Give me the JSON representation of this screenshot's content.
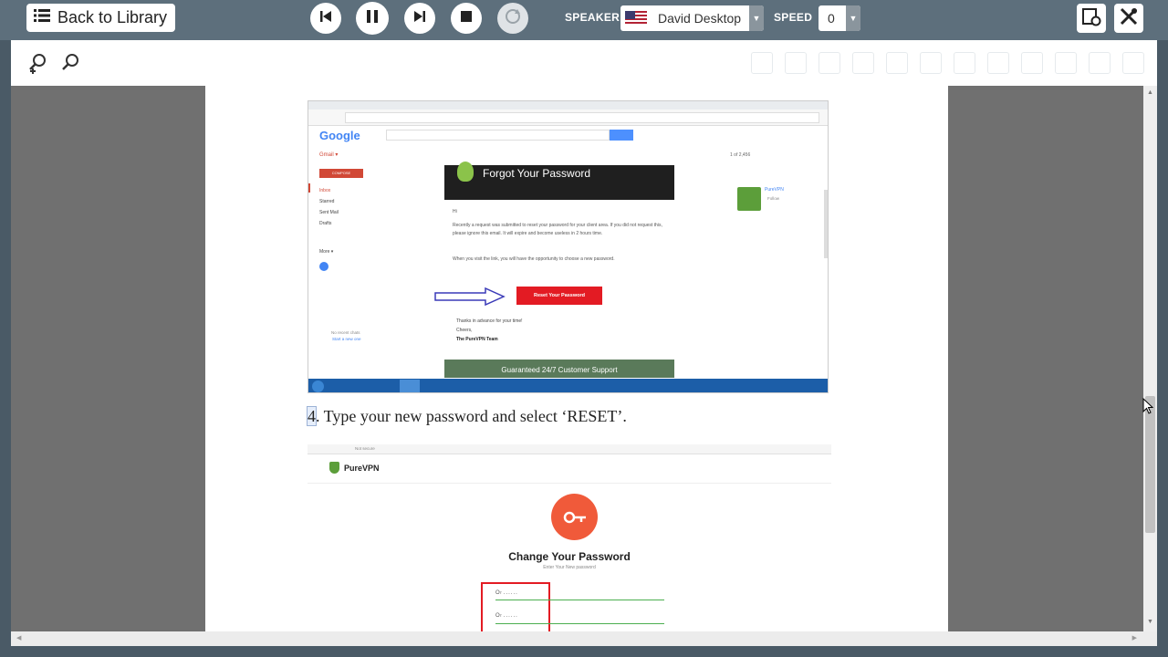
{
  "topbar": {
    "back_label": "Back to Library",
    "speaker_label": "SPEAKER",
    "speaker_value": "David Desktop",
    "speed_label": "SPEED",
    "speed_value": "0"
  },
  "colors": {
    "topbar": "#5d6f7c",
    "viewer_bg": "#707070",
    "accent_red": "#e31b23",
    "purevpn_orange": "#f05a3a",
    "gmail_red": "#d14836",
    "support_green": "#5a7a5a"
  },
  "document": {
    "step4_number": "4",
    "step4_text": ". Type your new password and select ‘RESET’."
  },
  "screenshot1": {
    "logo": "Google",
    "app_label": "Gmail ▾",
    "compose": "COMPOSE",
    "folders": [
      "Inbox",
      "Starred",
      "Sent Mail",
      "Drafts"
    ],
    "more": "More ▾",
    "email_header": "Forgot Your Password",
    "greeting": "Hi",
    "para1": "Recently a request was submitted to reset your password for your client area. If you did not request this, please ignore this email. It will expire and become useless in 2 hours time.",
    "para2": "When you visit the link, you will have the opportunity to choose a new password.",
    "reset_button": "Reset Your Password",
    "thanks": "Thanks in advance for your time!",
    "cheers": "Cheers,",
    "team": "The PureVPN Team",
    "support_banner": "Guaranteed 24/7 Customer Support",
    "side_name": "PureVPN",
    "side_follow": "Follow",
    "pager": "1 of 2,456",
    "no_chats": "No recent chats",
    "start_new": "Start a new one"
  },
  "screenshot2": {
    "brand": "PureVPN",
    "url_prefix": "Not secure",
    "title": "Change Your Password",
    "subtitle": "Enter Your New password"
  }
}
